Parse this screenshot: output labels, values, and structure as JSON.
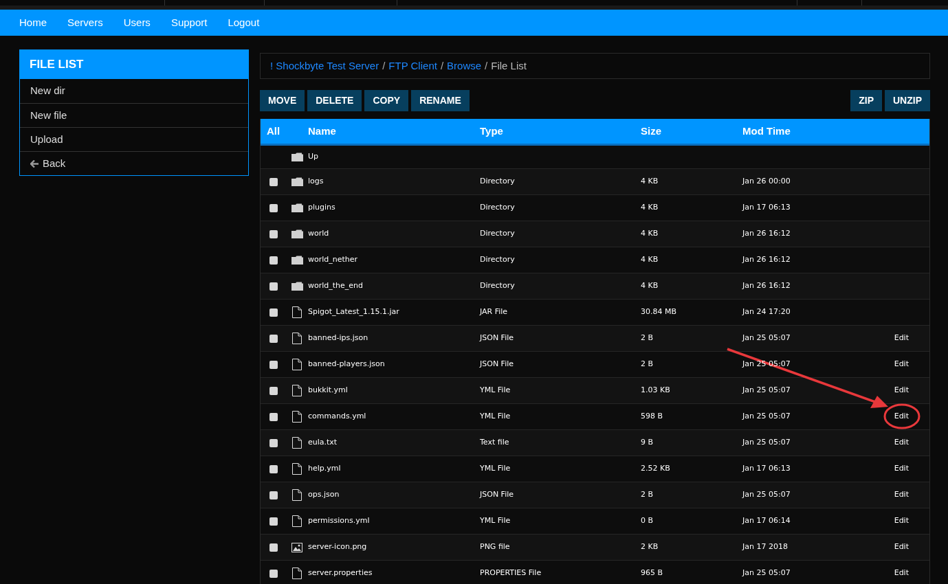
{
  "nav": {
    "items": [
      "Home",
      "Servers",
      "Users",
      "Support",
      "Logout"
    ]
  },
  "sidebar": {
    "title": "FILE LIST",
    "items": [
      {
        "label": "New dir",
        "kind": "plain"
      },
      {
        "label": "New file",
        "kind": "plain"
      },
      {
        "label": "Upload",
        "kind": "plain"
      },
      {
        "label": "Back",
        "kind": "back"
      }
    ]
  },
  "breadcrumb": [
    {
      "kind": "link",
      "label": "! Shockbyte Test Server"
    },
    {
      "kind": "separator",
      "label": "/"
    },
    {
      "kind": "link",
      "label": "FTP Client"
    },
    {
      "kind": "separator",
      "label": "/"
    },
    {
      "kind": "link",
      "label": "Browse"
    },
    {
      "kind": "separator",
      "label": "/"
    },
    {
      "kind": "current",
      "label": "File List"
    }
  ],
  "toolbar": {
    "left": [
      "MOVE",
      "DELETE",
      "COPY",
      "RENAME"
    ],
    "right": [
      "ZIP",
      "UNZIP"
    ]
  },
  "table": {
    "columns": [
      "All",
      "Name",
      "Type",
      "Size",
      "Mod Time"
    ],
    "up_row": {
      "name": "Up"
    },
    "rows": [
      {
        "kind": "folder",
        "checked": false,
        "name": "logs",
        "type": "Directory",
        "size": "4 KB",
        "mod_time": "Jan 26 00:00"
      },
      {
        "kind": "folder",
        "checked": false,
        "name": "plugins",
        "type": "Directory",
        "size": "4 KB",
        "mod_time": "Jan 17 06:13"
      },
      {
        "kind": "folder",
        "checked": false,
        "name": "world",
        "type": "Directory",
        "size": "4 KB",
        "mod_time": "Jan 26 16:12"
      },
      {
        "kind": "folder",
        "checked": false,
        "name": "world_nether",
        "type": "Directory",
        "size": "4 KB",
        "mod_time": "Jan 26 16:12"
      },
      {
        "kind": "folder",
        "checked": false,
        "name": "world_the_end",
        "type": "Directory",
        "size": "4 KB",
        "mod_time": "Jan 26 16:12"
      },
      {
        "kind": "file",
        "checked": false,
        "name": "Spigot_Latest_1.15.1.jar",
        "type": "JAR File",
        "size": "30.84 MB",
        "mod_time": "Jan 24 17:20"
      },
      {
        "kind": "file",
        "checked": false,
        "name": "banned-ips.json",
        "type": "JSON File",
        "size": "2 B",
        "mod_time": "Jan 25 05:07",
        "action": "Edit"
      },
      {
        "kind": "file",
        "checked": false,
        "name": "banned-players.json",
        "type": "JSON File",
        "size": "2 B",
        "mod_time": "Jan 25 05:07",
        "action": "Edit"
      },
      {
        "kind": "file",
        "checked": false,
        "name": "bukkit.yml",
        "type": "YML File",
        "size": "1.03 KB",
        "mod_time": "Jan 25 05:07",
        "action": "Edit"
      },
      {
        "kind": "file",
        "checked": false,
        "name": "commands.yml",
        "type": "YML File",
        "size": "598 B",
        "mod_time": "Jan 25 05:07",
        "action": "Edit",
        "highlighted": true
      },
      {
        "kind": "file",
        "checked": false,
        "name": "eula.txt",
        "type": "Text file",
        "size": "9 B",
        "mod_time": "Jan 25 05:07",
        "action": "Edit"
      },
      {
        "kind": "file",
        "checked": false,
        "name": "help.yml",
        "type": "YML File",
        "size": "2.52 KB",
        "mod_time": "Jan 17 06:13",
        "action": "Edit"
      },
      {
        "kind": "file",
        "checked": false,
        "name": "ops.json",
        "type": "JSON File",
        "size": "2 B",
        "mod_time": "Jan 25 05:07",
        "action": "Edit"
      },
      {
        "kind": "file",
        "checked": false,
        "name": "permissions.yml",
        "type": "YML File",
        "size": "0 B",
        "mod_time": "Jan 17 06:14",
        "action": "Edit"
      },
      {
        "kind": "image",
        "checked": false,
        "name": "server-icon.png",
        "type": "PNG file",
        "size": "2 KB",
        "mod_time": "Jan 17 2018",
        "action": "Edit"
      },
      {
        "kind": "file",
        "checked": false,
        "name": "server.properties",
        "type": "PROPERTIES File",
        "size": "965 B",
        "mod_time": "Jan 25 05:07",
        "action": "Edit"
      }
    ]
  }
}
